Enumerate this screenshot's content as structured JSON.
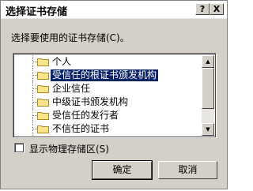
{
  "window": {
    "title": "选择证书存储",
    "help_label": "?",
    "close_label": "X"
  },
  "prompt": {
    "label": "选择要使用的证书存储(C)。"
  },
  "stores": {
    "items": [
      {
        "label": "个人",
        "selected": false
      },
      {
        "label": "受信任的根证书颁发机构",
        "selected": true
      },
      {
        "label": "企业信任",
        "selected": false
      },
      {
        "label": "中级证书颁发机构",
        "selected": false
      },
      {
        "label": "受信任的发行者",
        "selected": false
      },
      {
        "label": "不信任的证书",
        "selected": false
      }
    ]
  },
  "scrollbar": {
    "up_glyph": "▲",
    "down_glyph": "▼"
  },
  "show_physical": {
    "label": "显示物理存储区(S)",
    "checked": false
  },
  "buttons": {
    "ok_label": "确定",
    "cancel_label": "取消"
  },
  "colors": {
    "dialog_bg": "#d4d0c8",
    "selection_bg": "#0a246a",
    "folder_yellow": "#f8e48a",
    "folder_outline": "#b08820"
  }
}
